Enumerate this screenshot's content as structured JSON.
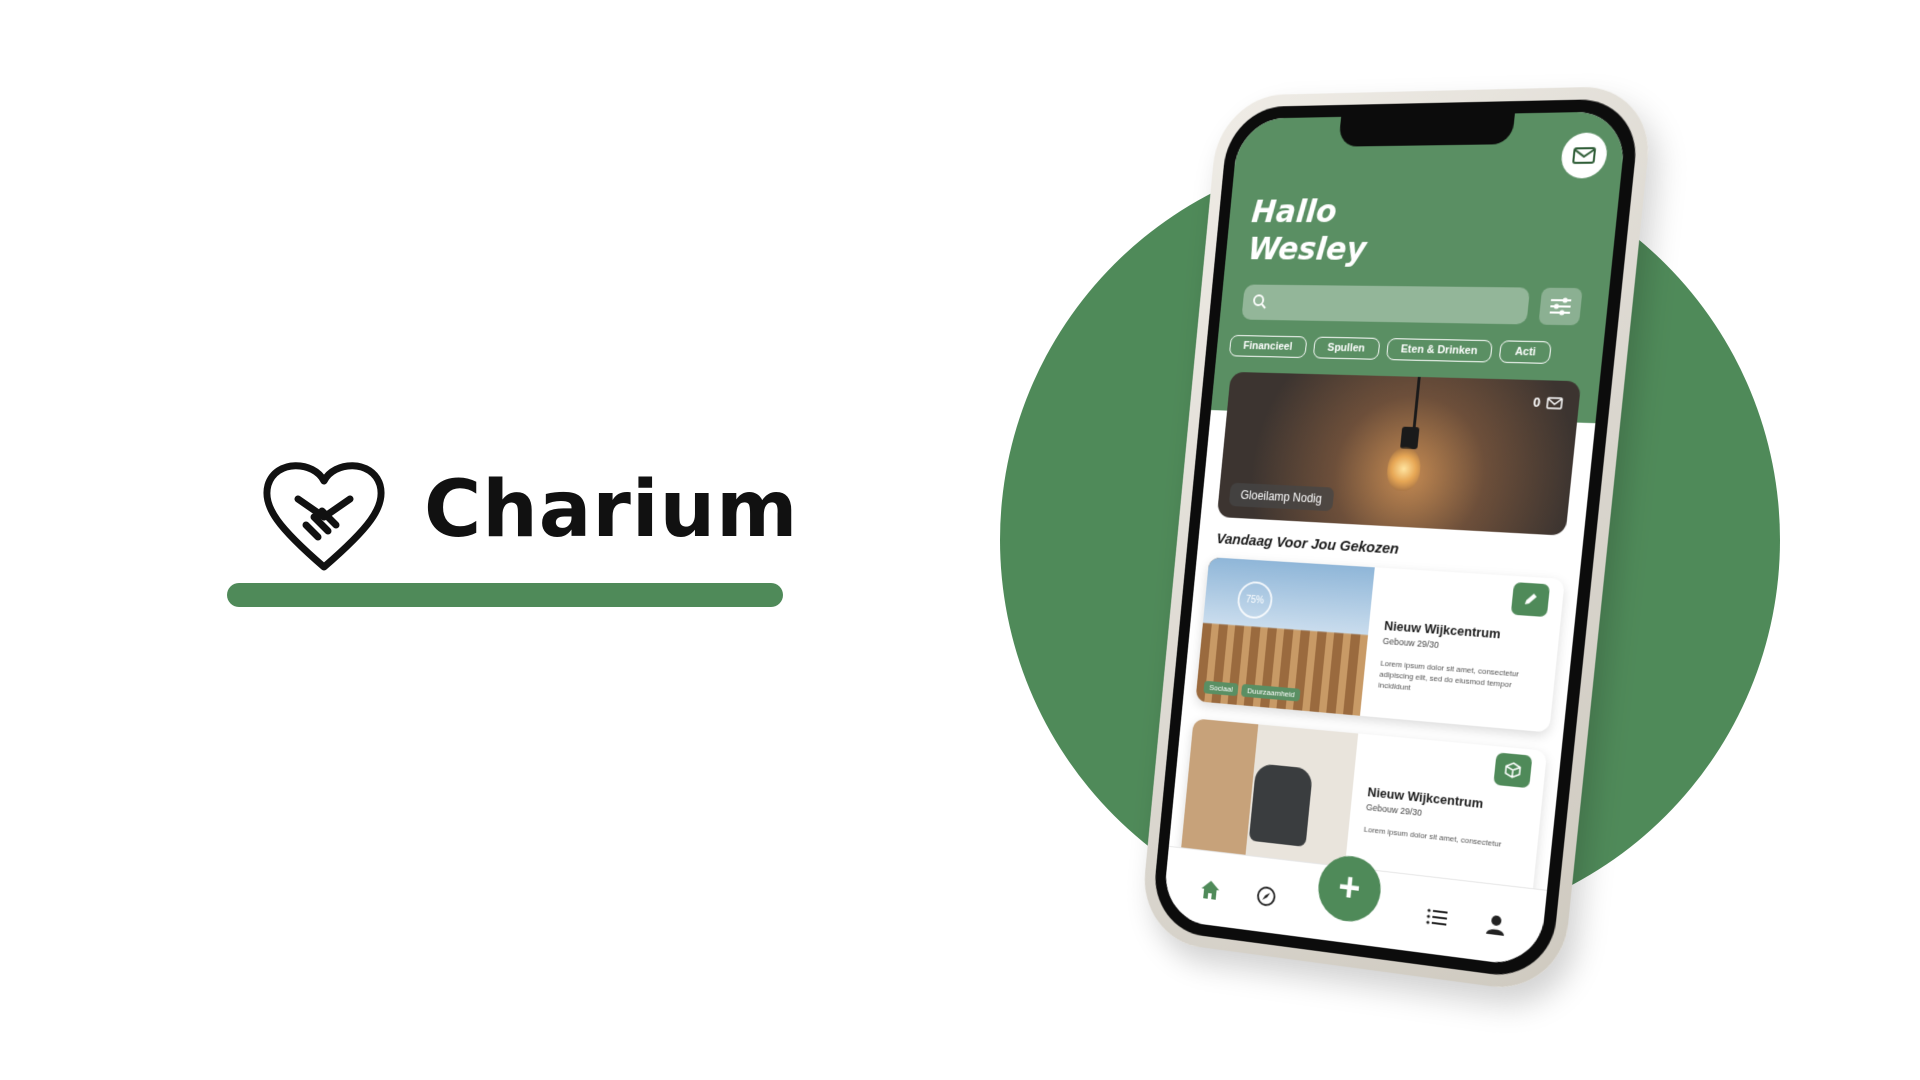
{
  "brand": {
    "name": "Charium",
    "accent_color": "#4f8a59"
  },
  "app": {
    "greeting_line1": "Hallo",
    "greeting_line2": "Wesley",
    "header_color": "#5a8f63",
    "categories": [
      "Financieel",
      "Spullen",
      "Eten & Drinken",
      "Acti"
    ],
    "hero": {
      "count": "0",
      "tag": "Gloeilamp Nodig"
    },
    "section_title": "Vandaag Voor Jou Gekozen",
    "cards": [
      {
        "title": "Nieuw Wijkcentrum",
        "progress": "75%",
        "location": "Gebouw 29/30",
        "description": "Lorem ipsum dolor sit amet, consectetur adipiscing elit, sed do eiusmod tempor incididunt",
        "image_tags": [
          "Sociaal",
          "Duurzaamheid"
        ]
      },
      {
        "title": "Nieuw Wijkcentrum",
        "location": "Gebouw 29/30",
        "description": "Lorem ipsum dolor sit amet, consectetur"
      }
    ],
    "tabbar": {
      "add_label": "+",
      "icons": [
        "home-icon",
        "compass-icon",
        "list-icon",
        "user-icon"
      ]
    }
  }
}
